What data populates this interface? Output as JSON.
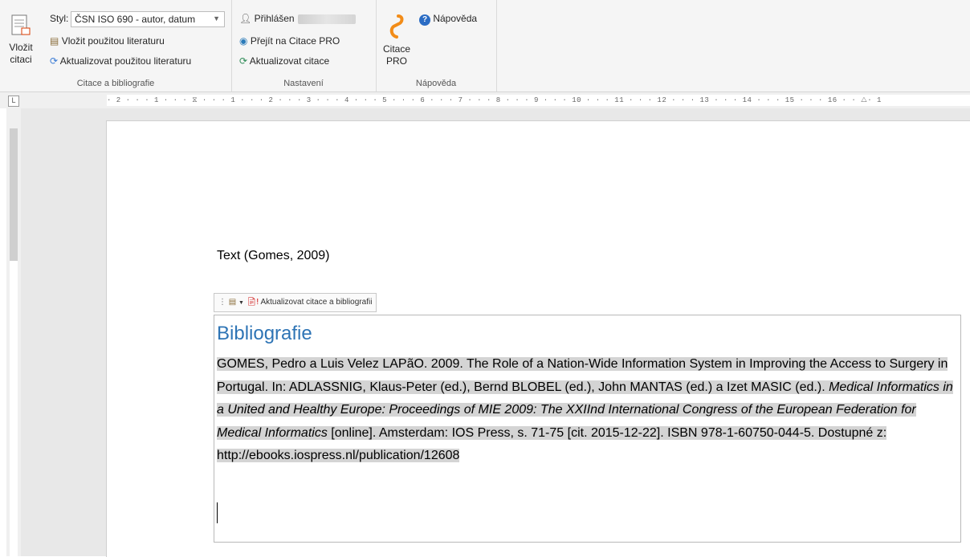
{
  "ribbon": {
    "insert_citation": {
      "line1": "Vložit",
      "line2": "citaci"
    },
    "style_label": "Styl:",
    "style_value": "ČSN ISO 690 - autor, datum",
    "insert_used_lit": "Vložit použitou literaturu",
    "update_used_lit": "Aktualizovat použitou literaturu",
    "group1_label": "Citace a bibliografie",
    "logged_in": "Přihlášen",
    "goto_citace": "Přejít na Citace PRO",
    "update_citations": "Aktualizovat citace",
    "group2_label": "Nastavení",
    "citace_pro": {
      "line1": "Citace",
      "line2": "PRO"
    },
    "help": "Nápověda",
    "group3_label": "Nápověda"
  },
  "ruler": {
    "corner": "L",
    "ticks": "· 2 · · · 1 · · · ⧖ · · · 1 · · · 2 · · · 3 · · · 4 · · · 5 · · · 6 · · · 7 · · · 8 · · · 9 · · · 10 · · · 11 · · · 12 · · · 13 · · · 14 · · · 15 · · · 16 · · △· 1"
  },
  "document": {
    "text": "Text (Gomes, 2009)",
    "content_control_label": "Aktualizovat citace a bibliografii",
    "bibliography_title": "Bibliografie",
    "entry": {
      "part1": "GOMES, Pedro a Luis Velez LAPãO. 2009. The Role of a Nation-Wide Information System in Improving the Access to Surgery in Portugal. In: ADLASSNIG, Klaus-Peter (ed.), Bernd BLOBEL (ed.), John MANTAS (ed.) a Izet MASIC (ed.). ",
      "italic": "Medical Informatics in a United and Healthy Europe: Proceedings of MIE 2009: The XXIInd International Congress of the European Federation for Medical Informatics",
      "part2": " [online]. Amsterdam: IOS Press, s. 71-75 [cit. 2015-12-22]. ISBN 978-1-60750-044-5. Dostupné z: http://ebooks.iospress.nl/publication/12608"
    }
  },
  "colors": {
    "accent": "#2e74b5",
    "highlight": "#d4d4d4"
  }
}
